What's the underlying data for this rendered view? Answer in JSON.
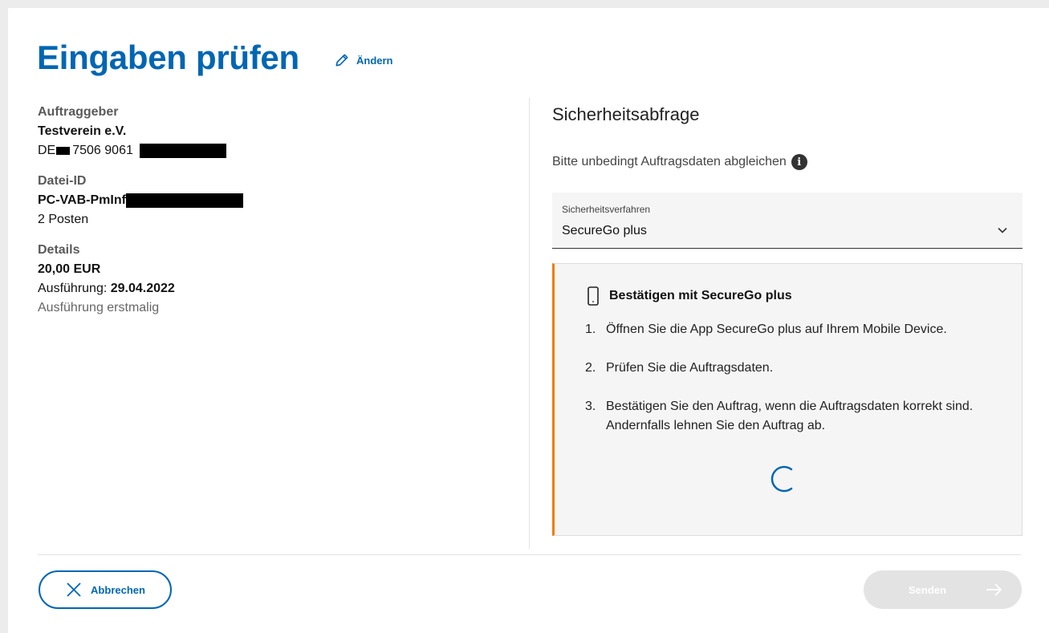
{
  "page": {
    "title": "Eingaben prüfen",
    "edit_label": "Ändern"
  },
  "summary": {
    "client_label": "Auftraggeber",
    "client_name": "Testverein e.V.",
    "iban_prefix": "DE",
    "iban_middle": "7506 9061",
    "file_label": "Datei-ID",
    "file_id_prefix": "PC-VAB-PmInf",
    "items_count": "2 Posten",
    "details_label": "Details",
    "amount": "20,00 EUR",
    "execution_label": "Ausführung: ",
    "execution_date": "29.04.2022",
    "execution_note": "Ausführung erstmalig"
  },
  "security": {
    "title": "Sicherheitsabfrage",
    "hint": "Bitte unbedingt Auftragsdaten abgleichen",
    "info_icon": "i",
    "select_label": "Sicherheitsverfahren",
    "select_value": "SecureGo plus",
    "panel_title": "Bestätigen mit SecureGo plus",
    "steps": [
      {
        "num": "1.",
        "text": "Öffnen Sie die App SecureGo plus auf Ihrem Mobile Device."
      },
      {
        "num": "2.",
        "text": "Prüfen Sie die Auftragsdaten."
      },
      {
        "num": "3.",
        "text": "Bestätigen Sie den Auftrag, wenn die Auftragsdaten korrekt sind. Andernfalls lehnen Sie den Auftrag ab."
      }
    ]
  },
  "footer": {
    "cancel_label": "Abbrechen",
    "send_label": "Senden"
  },
  "colors": {
    "primary": "#0066b3",
    "accent": "#f07d00",
    "disabled": "#e3e3e3"
  }
}
